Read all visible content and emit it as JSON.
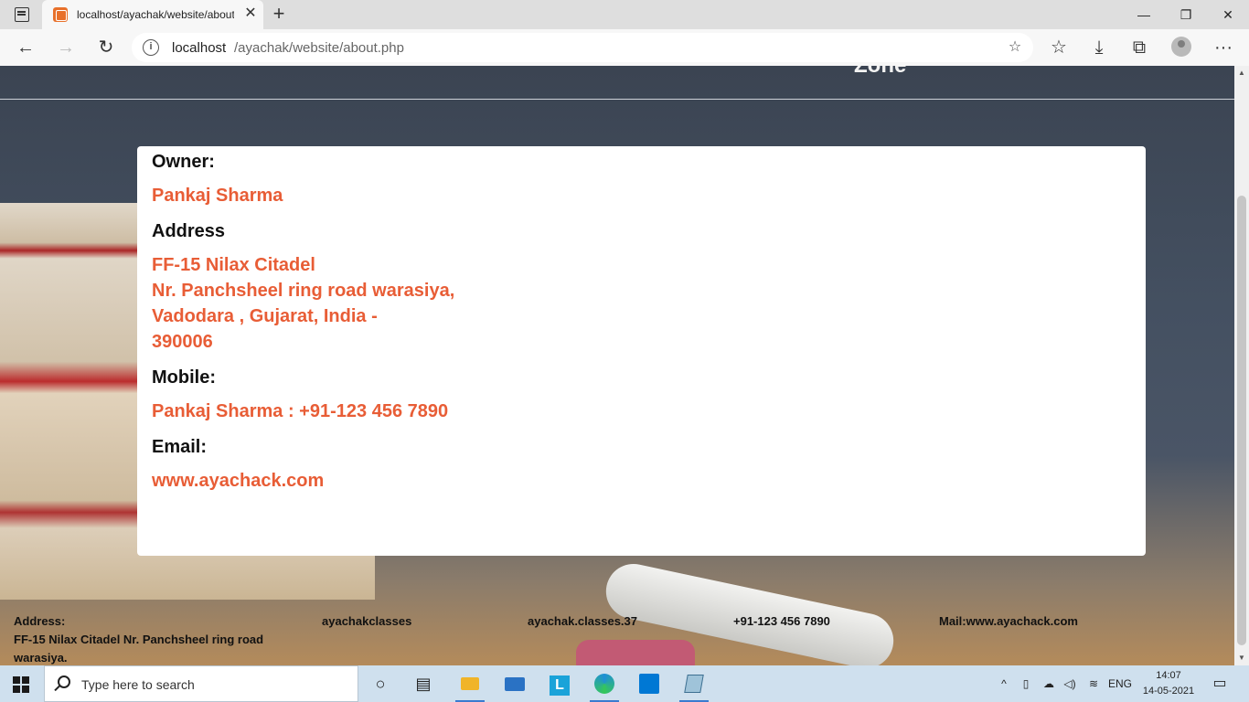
{
  "browser": {
    "tab_title": "localhost/ayachak/website/about.php",
    "tab_close": "✕",
    "new_tab": "+",
    "win_min": "—",
    "win_max": "❐",
    "win_close": "✕",
    "back": "←",
    "forward": "→",
    "refresh": "↻",
    "address_host": "localhost",
    "address_path": "/ayachak/website/about.php",
    "info": "i",
    "add_favorite": "☆",
    "favorites": "☆",
    "downloads": "⤓",
    "collections": "⧉",
    "more": "···"
  },
  "page": {
    "header_fragment": "Zone",
    "owner_label": "Owner:",
    "owner_name": "Pankaj Sharma",
    "address_label": "Address",
    "address_lines": [
      "FF-15 Nilax Citadel",
      "Nr. Panchsheel ring road warasiya,",
      "Vadodara , Gujarat, India -",
      "390006"
    ],
    "mobile_label": "Mobile:",
    "mobile_value": "Pankaj Sharma : +91-123 456 7890",
    "email_label": "Email:",
    "email_value": "www.ayachack.com"
  },
  "footer": {
    "address_label": "Address:",
    "address_line1": "FF-15 Nilax Citadel Nr. Panchsheel ring road",
    "address_line2": "warasiya.",
    "instagram": "ayachakclasses",
    "facebook": "ayachak.classes.37",
    "phone": "+91-123 456 7890",
    "mail": "Mail:www.ayachack.com"
  },
  "scrollbar": {
    "up": "▲",
    "down": "▼"
  },
  "taskbar": {
    "search_placeholder": "Type here to search",
    "task_view": "○",
    "widgets": "▤",
    "tray_chevron": "^",
    "language": "ENG",
    "time": "14:07",
    "date": "14-05-2021",
    "notifications": "▭",
    "colors": {
      "edge": "#1f8fd6",
      "explorer": "#f0b429",
      "mail": "#2a72c4",
      "l_app": "#1aa3d9",
      "store": "#0078d4"
    }
  }
}
